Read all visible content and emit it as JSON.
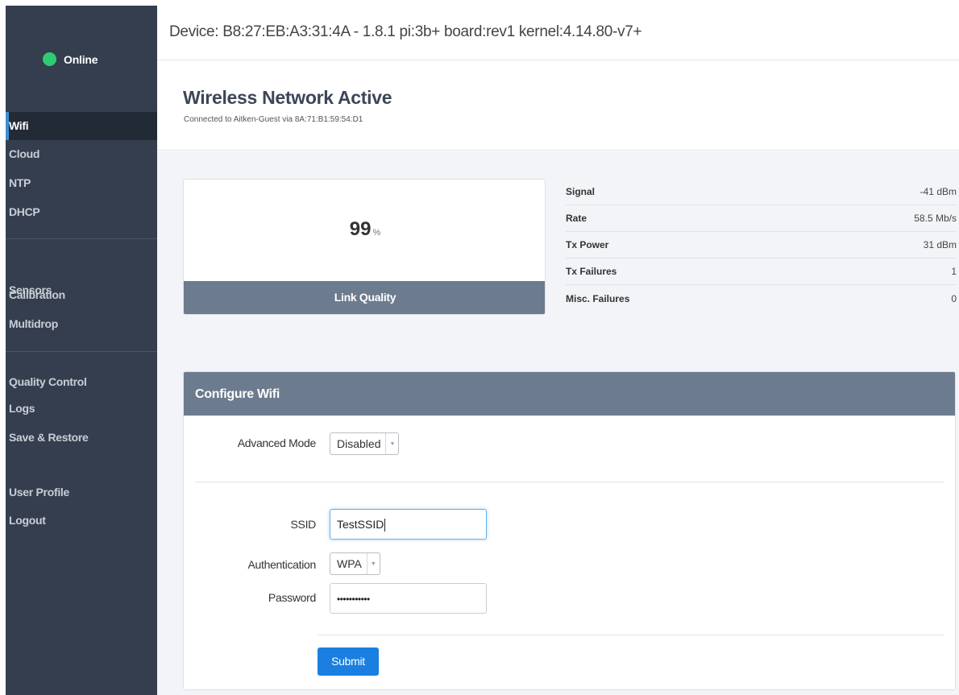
{
  "sidebar": {
    "status": {
      "label": "Online",
      "color": "#2ecc71"
    },
    "items": [
      {
        "label": "Wifi",
        "active": true
      },
      {
        "label": "Cloud"
      },
      {
        "label": "NTP"
      },
      {
        "label": "DHCP"
      },
      {
        "label": "Sensors"
      },
      {
        "label": "Calibration"
      },
      {
        "label": "Multidrop"
      },
      {
        "label": "Quality Control"
      },
      {
        "label": "Logs"
      },
      {
        "label": "Save & Restore"
      },
      {
        "label": "User Profile"
      },
      {
        "label": "Logout"
      }
    ]
  },
  "header": {
    "device_info": "Device: B8:27:EB:A3:31:4A - 1.8.1 pi:3b+ board:rev1 kernel:4.14.80-v7+"
  },
  "page": {
    "title": "Wireless Network Active",
    "subtitle": "Connected to Aitken-Guest via 8A:71:B1:59:54:D1"
  },
  "link_quality": {
    "value": "99",
    "unit": "%",
    "label": "Link Quality"
  },
  "stats": [
    {
      "label": "Signal",
      "value": "-41 dBm"
    },
    {
      "label": "Rate",
      "value": "58.5 Mb/s"
    },
    {
      "label": "Tx Power",
      "value": "31 dBm"
    },
    {
      "label": "Tx Failures",
      "value": "1"
    },
    {
      "label": "Misc. Failures",
      "value": "0"
    }
  ],
  "configure": {
    "title": "Configure Wifi",
    "advanced_mode": {
      "label": "Advanced Mode",
      "value": "Disabled"
    },
    "ssid": {
      "label": "SSID",
      "value": "TestSSID"
    },
    "authentication": {
      "label": "Authentication",
      "value": "WPA"
    },
    "password": {
      "label": "Password",
      "value": "•••••••••••"
    },
    "submit_label": "Submit"
  },
  "colors": {
    "sidebar_bg": "#343e4e",
    "sidebar_active": "#222a36",
    "panel_header": "#6d7b8e",
    "accent": "#1a7fe0",
    "online": "#2ecc71"
  }
}
